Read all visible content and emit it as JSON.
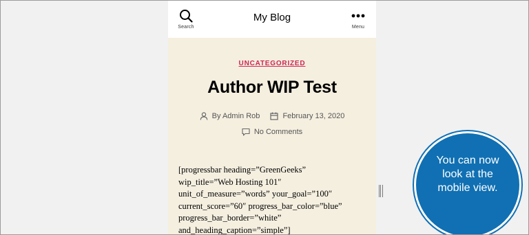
{
  "header": {
    "search_label": "Search",
    "site_title": "My Blog",
    "menu_label": "Menu"
  },
  "post": {
    "category": "UNCATEGORIZED",
    "title": "Author WIP Test",
    "author": "By Admin Rob",
    "date": "February 13, 2020",
    "comments": "No Comments",
    "content_lines": [
      "[progressbar heading=”GreenGeeks”",
      "wip_title=”Web Hosting 101″",
      "unit_of_measure=”words” your_goal=”100″",
      "current_score=”60″ progress_bar_color=”blue”",
      "progress_bar_border=”white”",
      "and_heading_caption=”simple”]"
    ]
  },
  "callout": {
    "text": "You can now look at the mobile view."
  },
  "colors": {
    "accent": "#cd2653",
    "content_background": "#f5efe0",
    "callout_background": "#1070b3"
  },
  "icons": {
    "search": "search-icon",
    "menu": "more-dots-icon",
    "author": "user-icon",
    "date": "calendar-icon",
    "comments": "comment-icon"
  }
}
